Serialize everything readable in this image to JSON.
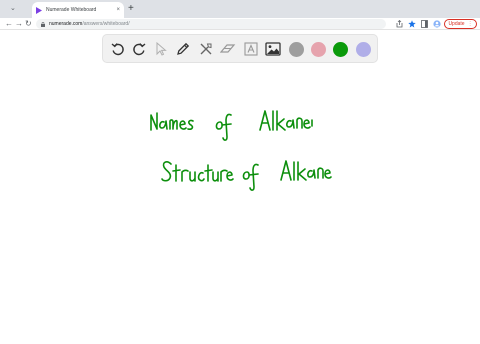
{
  "browser": {
    "tab_title": "Numerade Whiteboard",
    "tab_close": "×",
    "new_tab": "+",
    "url_host": "numerade.com",
    "url_path": "/answers/whiteboard/",
    "update_label": "Update",
    "update_more": "⋮"
  },
  "toolbar_tools": [
    {
      "name": "undo-icon"
    },
    {
      "name": "redo-icon"
    },
    {
      "name": "select-pointer-icon"
    },
    {
      "name": "pen-icon"
    },
    {
      "name": "tools-icon"
    },
    {
      "name": "eraser-icon"
    },
    {
      "name": "text-icon"
    },
    {
      "name": "image-icon"
    }
  ],
  "colors": {
    "swatch_gray": "#9e9e9e",
    "swatch_pink": "#e6a3ad",
    "swatch_green": "#0b9a0b",
    "swatch_lavender": "#b0aee8",
    "ink": "#0d8f0d",
    "update_red": "#d93025"
  },
  "handwriting": {
    "line1": "Names of Alkanes",
    "line2": "Structure of Alkanes"
  }
}
